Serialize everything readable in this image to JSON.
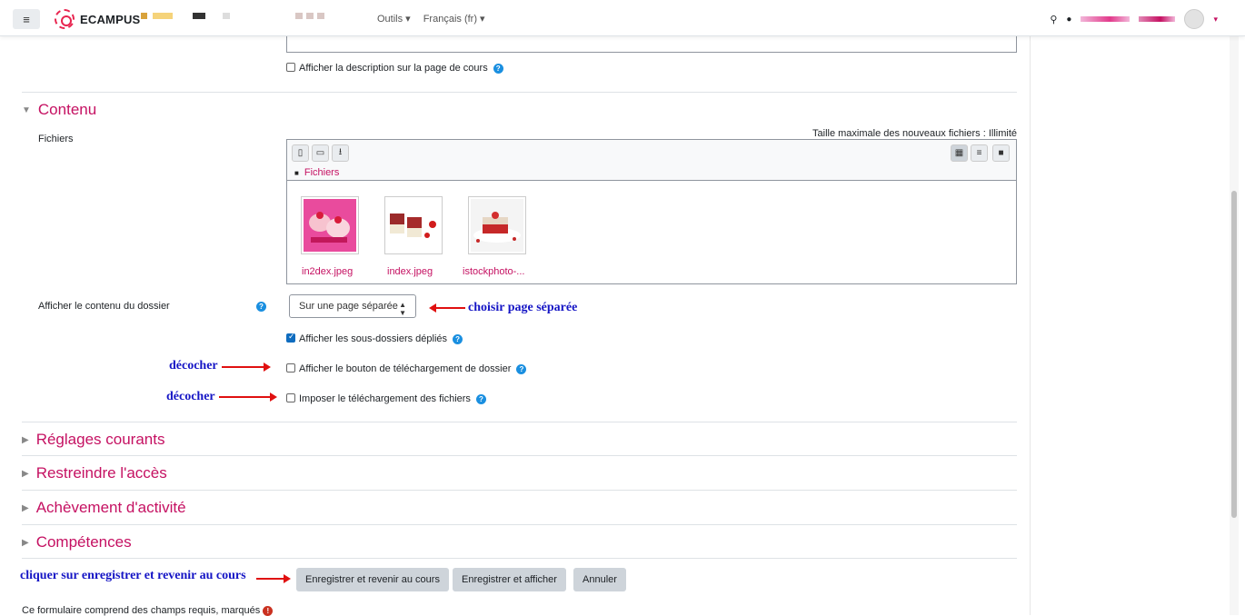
{
  "navbar": {
    "menu_icon": "hamburger-icon",
    "brand": "ECAMPUS",
    "tools": "Outils ▾",
    "language": "Français (fr) ▾",
    "search_icon": "search-icon",
    "messages_icon": "chat-icon",
    "user_menu_caret": "▾"
  },
  "description": {
    "show_on_course_page": "Afficher la description sur la page de cours"
  },
  "contenu": {
    "section_title": "Contenu",
    "files_label": "Fichiers",
    "max_size": "Taille maximale des nouveaux fichiers : Illimité",
    "fm_path": "Fichiers",
    "files": [
      {
        "name": "in2dex.jpeg"
      },
      {
        "name": "index.jpeg"
      },
      {
        "name": "istockphoto-..."
      }
    ],
    "display_label": "Afficher le contenu du dossier",
    "display_value": "Sur une page séparée",
    "show_subfolders": "Afficher les sous-dossiers dépliés",
    "show_download_button": "Afficher le bouton de téléchargement de dossier",
    "force_download": "Imposer le téléchargement des fichiers"
  },
  "sections": [
    "Réglages courants",
    "Restreindre l'accès",
    "Achèvement d'activité",
    "Compétences"
  ],
  "buttons": {
    "save_return": "Enregistrer et revenir au cours",
    "save_display": "Enregistrer et afficher",
    "cancel": "Annuler"
  },
  "footer_note": "Ce formulaire comprend des champs requis, marqués",
  "annotations": {
    "choose_page": "choisir page séparée",
    "uncheck_1": "décocher",
    "uncheck_2": "décocher",
    "click_save": "cliquer sur enregistrer et revenir au cours"
  }
}
